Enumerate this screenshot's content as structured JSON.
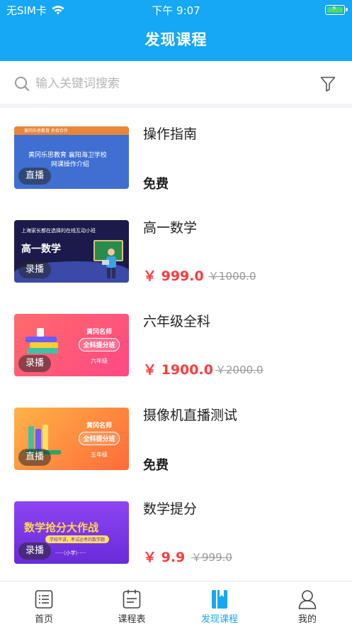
{
  "status_bar": {
    "carrier": "无SIM卡",
    "time": "下午 9:07"
  },
  "header": {
    "title": "发现课程"
  },
  "search": {
    "placeholder": "输入关键词搜索"
  },
  "courses": [
    {
      "name": "操作指南",
      "tag": "直播",
      "free_label": "免费",
      "thumb": {
        "band_text": "黄冈乐思教育 名校合作",
        "line1": "黄冈乐思教育 襄阳海卫学校",
        "line2": "网课操作介绍"
      }
    },
    {
      "name": "高一数学",
      "tag": "录播",
      "price": "￥ 999.0",
      "original_price": "￥1000.0",
      "thumb": {
        "line1": "上海家长都在选择的在线互动小班",
        "big": "高一数学"
      }
    },
    {
      "name": "六年级全科",
      "tag": "录播",
      "price": "￥ 1900.0",
      "original_price": "￥2000.0",
      "thumb": {
        "b1": "黄冈名师",
        "b2": "全科提分班",
        "b3": "六年级"
      }
    },
    {
      "name": "摄像机直播测试",
      "tag": "直播",
      "free_label": "免费",
      "thumb": {
        "b1": "黄冈名师",
        "b2": "全科提分班",
        "b3": "五年级"
      }
    },
    {
      "name": "数学提分",
      "tag": "录播",
      "price": "￥ 9.9",
      "original_price": "￥999.0",
      "thumb": {
        "title": "数学抢分大作战",
        "pill": "学校不讲，考试必考的数学题",
        "sub": "·····（小学）·····"
      }
    }
  ],
  "tabbar": [
    {
      "label": "首页",
      "icon": "home-list-icon",
      "active": false
    },
    {
      "label": "课程表",
      "icon": "schedule-icon",
      "active": false
    },
    {
      "label": "发现课程",
      "icon": "discover-book-icon",
      "active": true
    },
    {
      "label": "我的",
      "icon": "profile-icon",
      "active": false
    }
  ],
  "colors": {
    "brand": "#16a7f5",
    "price": "#ff3b3b",
    "active_tab": "#16a7f5"
  }
}
